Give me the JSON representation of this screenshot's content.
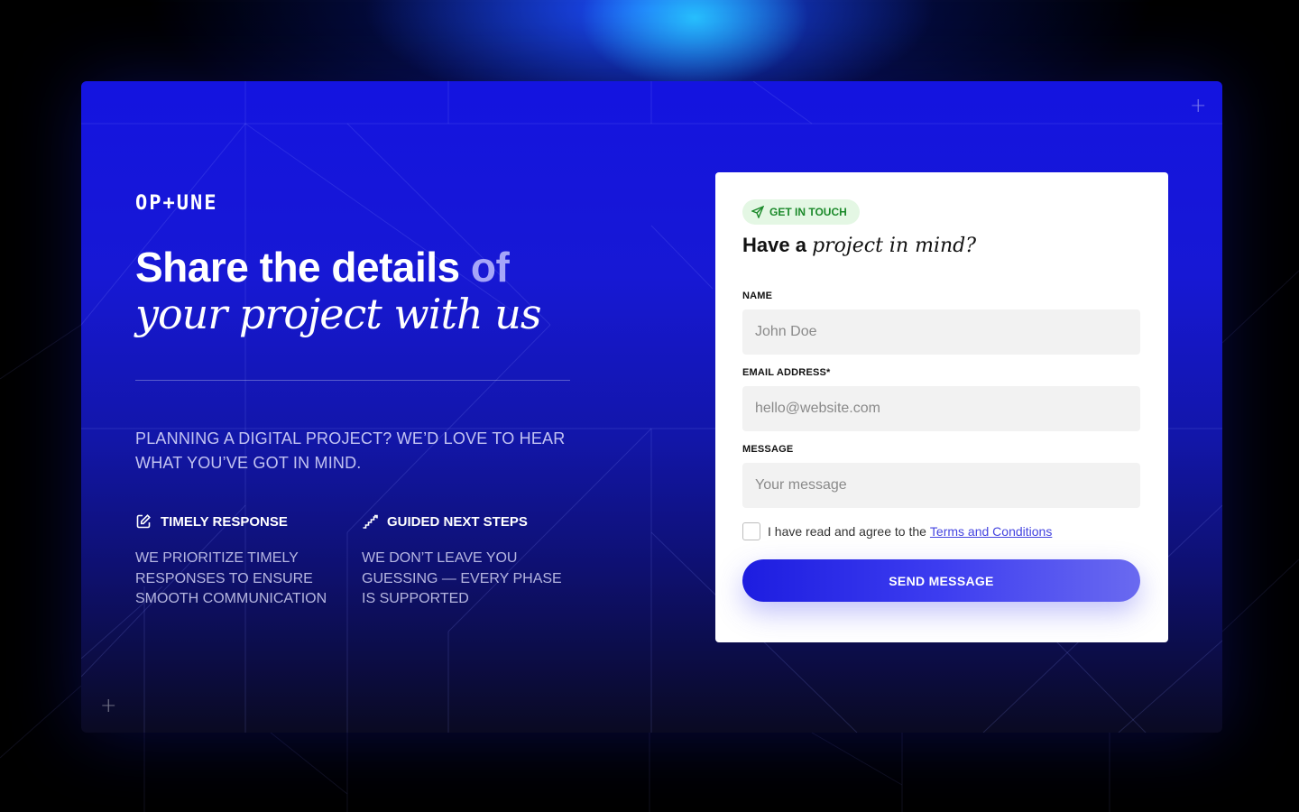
{
  "brand": {
    "logo": "OP+UNE"
  },
  "hero": {
    "title_line1_main": "Share the details ",
    "title_line1_dim": "of",
    "title_line2": "your project with us",
    "intro": "PLANNING A DIGITAL PROJECT? WE’D LOVE TO HEAR WHAT YOU’VE GOT IN MIND."
  },
  "features": [
    {
      "icon": "edit-icon",
      "title": "TIMELY RESPONSE",
      "desc": "WE PRIORITIZE TIMELY RESPONSES TO ENSURE SMOOTH COMMUNICATION"
    },
    {
      "icon": "steps-icon",
      "title": "GUIDED NEXT STEPS",
      "desc": "WE DON’T LEAVE YOU GUESSING — EVERY PHASE IS SUPPORTED"
    }
  ],
  "form": {
    "badge": "GET IN TOUCH",
    "badge_icon": "send-icon",
    "title_plain": "Have a ",
    "title_italic": "project in mind?",
    "name_label": "NAME",
    "name_placeholder": "John Doe",
    "email_label": "EMAIL ADDRESS*",
    "email_placeholder": "hello@website.com",
    "message_label": "MESSAGE",
    "message_placeholder": "Your message",
    "agree_text": "I have read and agree to the",
    "terms_link": "Terms and Conditions",
    "submit_label": "SEND MESSAGE"
  },
  "colors": {
    "card_top": "#1414e0",
    "card_bottom": "#0a0a22",
    "badge_bg": "#e4f7e4",
    "badge_text": "#1b8a2a",
    "button_start": "#1d1de0",
    "button_end": "#6a6af0"
  }
}
